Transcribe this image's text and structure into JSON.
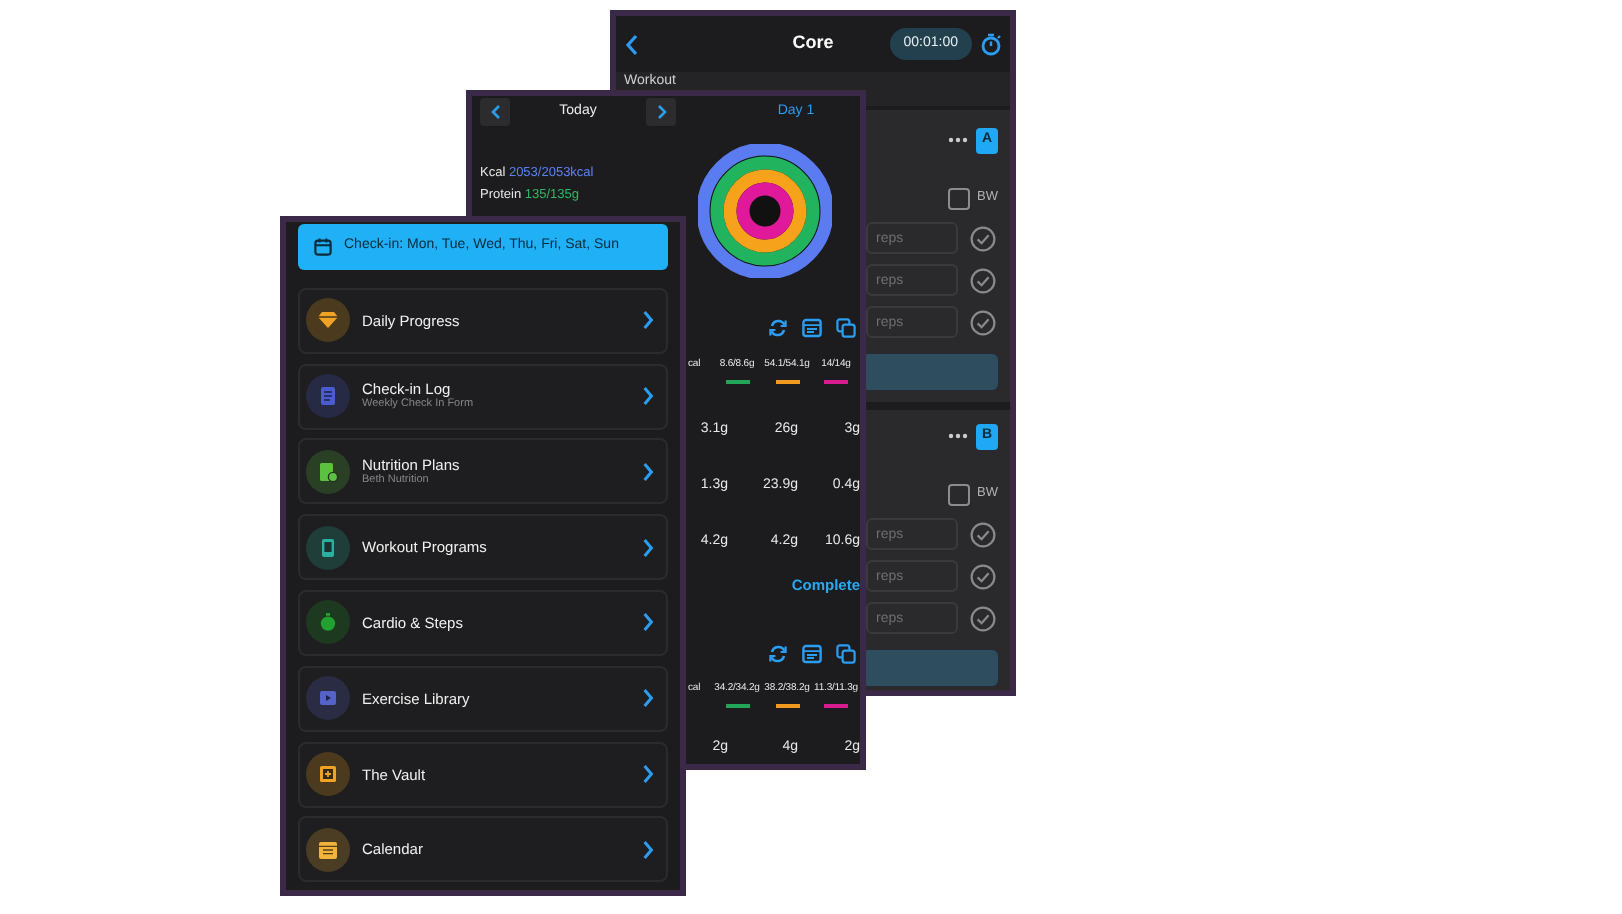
{
  "workout_screen": {
    "title": "Core",
    "timer": "00:01:00",
    "section": "Workout",
    "exercises": [
      {
        "tag": "A",
        "bw": {
          "label": "BW",
          "checked": false
        },
        "sets": [
          {
            "placeholder": "reps"
          },
          {
            "placeholder": "reps"
          },
          {
            "placeholder": "reps"
          }
        ]
      },
      {
        "tag": "B",
        "bw": {
          "label": "BW",
          "checked": false
        },
        "sets": [
          {
            "placeholder": "reps"
          },
          {
            "placeholder": "reps"
          },
          {
            "placeholder": "reps"
          }
        ]
      }
    ]
  },
  "nutrition_screen": {
    "date": "Today",
    "day": "Day 1",
    "summary": [
      {
        "label": "Kcal",
        "value": "2053/2053kcal",
        "color": "#5b82f5"
      },
      {
        "label": "Protein",
        "value": "135/135g",
        "color": "#2fb864"
      }
    ],
    "meals": [
      {
        "label": "cal",
        "macros": [
          {
            "text": "8.6/8.6g",
            "color": "#22a559"
          },
          {
            "text": "54.1/54.1g",
            "color": "#f29a1f"
          },
          {
            "text": "14/14g",
            "color": "#d81b8f"
          }
        ],
        "rows": [
          [
            "3.1g",
            "26g",
            "3g"
          ],
          [
            "1.3g",
            "23.9g",
            "0.4g"
          ],
          [
            "4.2g",
            "4.2g",
            "10.6g"
          ]
        ],
        "status": "Complete"
      },
      {
        "label": "cal",
        "macros": [
          {
            "text": "34.2/34.2g",
            "color": "#22a559"
          },
          {
            "text": "38.2/38.2g",
            "color": "#f29a1f"
          },
          {
            "text": "11.3/11.3g",
            "color": "#d81b8f"
          }
        ],
        "rows": [
          [
            "2g",
            "4g",
            "2g"
          ]
        ]
      }
    ]
  },
  "menu_screen": {
    "checkin": "Check-in: Mon, Tue, Wed, Thu, Fri, Sat, Sun",
    "items": [
      {
        "title": "Daily Progress",
        "color": "#f0a323"
      },
      {
        "title": "Check-in Log",
        "subtitle": "Weekly Check In Form",
        "color": "#4b5bd0"
      },
      {
        "title": "Nutrition Plans",
        "subtitle": "Beth Nutrition",
        "color": "#5cc040"
      },
      {
        "title": "Workout Programs",
        "color": "#2ab0a0"
      },
      {
        "title": "Cardio & Steps",
        "color": "#22a030"
      },
      {
        "title": "Exercise Library",
        "color": "#5563c8"
      },
      {
        "title": "The Vault",
        "color": "#f0a323"
      },
      {
        "title": "Calendar",
        "color": "#f2b33a"
      }
    ]
  }
}
